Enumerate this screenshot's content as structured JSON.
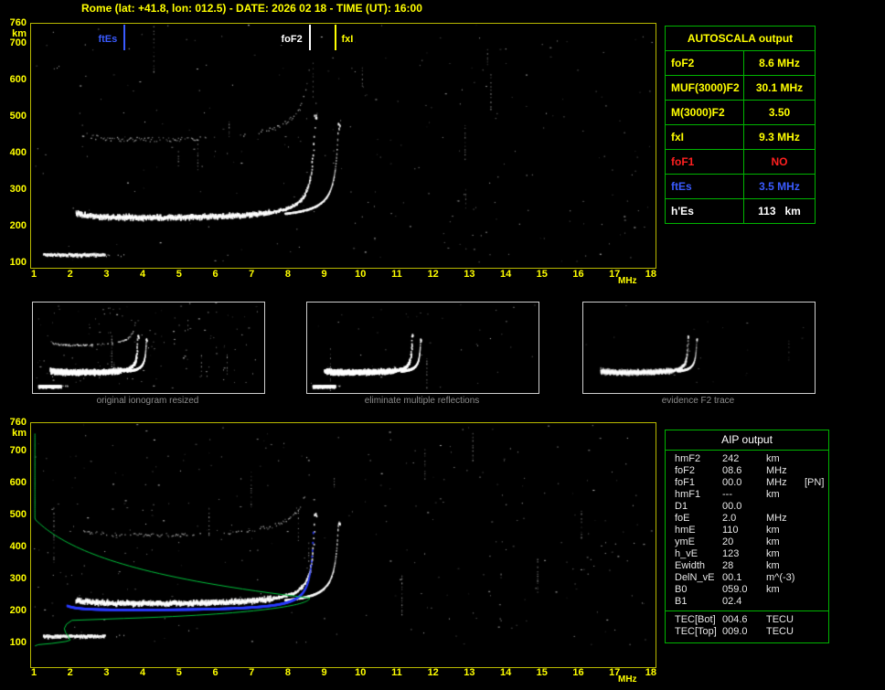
{
  "title": "Rome (lat: +41.8, lon: 012.5) - DATE: 2026 02 18 - TIME (UT): 16:00",
  "colors": {
    "axis_yellow": "#ffff00",
    "plot_border_yellow": "#b8b800",
    "table_green": "#00b400",
    "trace_blue": "#2a3cff",
    "profile_green": "#00c23c",
    "foF1_red": "#ff2020",
    "ftEs_blue": "#3a5bff",
    "caption_gray": "#8c8c8c"
  },
  "axes": {
    "y_max": "760",
    "y_unit": "km",
    "y_ticks": [
      "700",
      "600",
      "500",
      "400",
      "300",
      "200",
      "100"
    ],
    "x_ticks": [
      "1",
      "2",
      "3",
      "4",
      "5",
      "6",
      "7",
      "8",
      "9",
      "10",
      "11",
      "12",
      "13",
      "14",
      "15",
      "16",
      "17",
      "18"
    ],
    "x_unit": "MHz"
  },
  "top_plot": {
    "markers": [
      {
        "label": "ftEs",
        "freq_mhz": 3.5,
        "color": "#3a5bff",
        "label_side": "left"
      },
      {
        "label": "foF2",
        "freq_mhz": 8.6,
        "color": "#ffffff",
        "label_side": "left"
      },
      {
        "label": "fxI",
        "freq_mhz": 9.3,
        "color": "#ffff00",
        "label_side": "right"
      }
    ]
  },
  "autoscala": {
    "header": "AUTOSCALA output",
    "rows": [
      {
        "param": "foF2",
        "value": "8.6 MHz",
        "color": "#ffff00"
      },
      {
        "param": "MUF(3000)F2",
        "value": "30.1 MHz",
        "color": "#ffff00"
      },
      {
        "param": "M(3000)F2",
        "value": "3.50",
        "color": "#ffff00"
      },
      {
        "param": "fxI",
        "value": "9.3 MHz",
        "color": "#ffff00"
      },
      {
        "param": "foF1",
        "value": "NO",
        "color": "#ff2020"
      },
      {
        "param": "ftEs",
        "value": "3.5 MHz",
        "color": "#3a5bff"
      },
      {
        "param": "h'Es",
        "value": "113   km",
        "color": "#ffffff"
      }
    ]
  },
  "thumbnails": [
    {
      "caption": "original ionogram resized"
    },
    {
      "caption": "eliminate multiple reflections"
    },
    {
      "caption": "evidence F2 trace"
    }
  ],
  "aip": {
    "header": "AIP output",
    "rows": [
      {
        "param": "hmF2",
        "value": "242",
        "unit": "km",
        "note": ""
      },
      {
        "param": "foF2",
        "value": "08.6",
        "unit": "MHz",
        "note": ""
      },
      {
        "param": "foF1",
        "value": "00.0",
        "unit": "MHz",
        "note": "[PN]"
      },
      {
        "param": "hmF1",
        "value": "---",
        "unit": "km",
        "note": ""
      },
      {
        "param": "D1",
        "value": "00.0",
        "unit": "",
        "note": ""
      },
      {
        "param": "foE",
        "value": "2.0",
        "unit": "MHz",
        "note": ""
      },
      {
        "param": "hmE",
        "value": "110",
        "unit": "km",
        "note": ""
      },
      {
        "param": "ymE",
        "value": "20",
        "unit": "km",
        "note": ""
      },
      {
        "param": "h_vE",
        "value": "123",
        "unit": "km",
        "note": ""
      },
      {
        "param": "Ewidth",
        "value": "28",
        "unit": "km",
        "note": ""
      },
      {
        "param": "DelN_vE",
        "value": "00.1",
        "unit": "m^(-3)",
        "note": ""
      },
      {
        "param": "B0",
        "value": "059.0",
        "unit": "km",
        "note": ""
      },
      {
        "param": "B1",
        "value": "02.4",
        "unit": "",
        "note": ""
      }
    ],
    "tec_rows": [
      {
        "param": "TEC[Bot]",
        "value": "004.6",
        "unit": "TECU"
      },
      {
        "param": "TEC[Top]",
        "value": "009.0",
        "unit": "TECU"
      }
    ]
  },
  "chart_data": [
    {
      "type": "scatter",
      "title": "ionogram (top) with AUTOSCALA scaling markers",
      "xlabel": "MHz",
      "ylabel": "km",
      "xlim": [
        1,
        18
      ],
      "ylim": [
        100,
        760
      ],
      "grid": false,
      "markers": {
        "ftEs_MHz": 3.5,
        "foF2_MHz": 8.6,
        "fxI_MHz": 9.3,
        "hEs_km": 113
      },
      "features": [
        "sporadic-E trace near 110-125 km from 1.3 to 3.5 MHz",
        "F2 ordinary trace from ~225 km rising asymptotically at 8.6 MHz to ~500 km",
        "F2 extraordinary trace asymptotic at 9.3 MHz",
        "second-hop F2 echo near 450-470 km",
        "random noise speckle and vertical interference streaks"
      ]
    },
    {
      "type": "scatter+line",
      "title": "ionogram (bottom) with restored trace and electron-density profile",
      "xlabel": "MHz",
      "ylabel": "km",
      "xlim": [
        1,
        18
      ],
      "ylim": [
        100,
        760
      ],
      "profile_params": {
        "hmF2_km": 242,
        "foF2_MHz": 8.6,
        "foE_MHz": 2.0,
        "hmE_km": 110
      },
      "series": [
        {
          "name": "measured ionogram echoes",
          "color": "#ffffff"
        },
        {
          "name": "restored o-mode trace",
          "color": "#2a3cff"
        },
        {
          "name": "electron density profile N(h)",
          "color": "#00c23c"
        }
      ]
    }
  ]
}
